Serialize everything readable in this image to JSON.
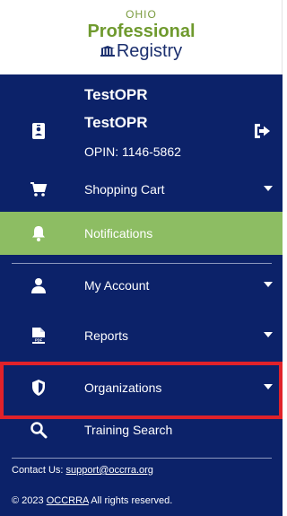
{
  "logo": {
    "ohio": "OHIO",
    "professional": "Professional",
    "registry": "Registry"
  },
  "user": {
    "name_line1": "TestOPR",
    "name_line2": "TestOPR",
    "opin": "OPIN: 1146-5862"
  },
  "nav": {
    "shopping_cart": "Shopping Cart",
    "notifications": "Notifications",
    "my_account": "My Account",
    "reports": "Reports",
    "organizations": "Organizations",
    "training_search": "Training Search"
  },
  "footer": {
    "contact_prefix": "Contact Us: ",
    "contact_email": "support@occrra.org",
    "copyright_prefix": "© 2023 ",
    "copyright_link": "OCCRRA",
    "copyright_suffix": " All rights reserved."
  },
  "colors": {
    "navy": "#0c2269",
    "active_green": "#8dbd63",
    "highlight_red": "#e0222a",
    "logo_green": "#6f9a2e",
    "logo_navy": "#1b2f6e"
  },
  "icons": {
    "user": "id-badge-icon",
    "logout": "logout-icon",
    "cart": "shopping-cart-icon",
    "bell": "bell-icon",
    "account": "person-icon",
    "reports": "pdf-file-icon",
    "organizations": "shield-icon",
    "search": "search-icon",
    "chevron": "chevron-down-icon"
  },
  "active_item": "notifications",
  "highlighted_item": "organizations"
}
